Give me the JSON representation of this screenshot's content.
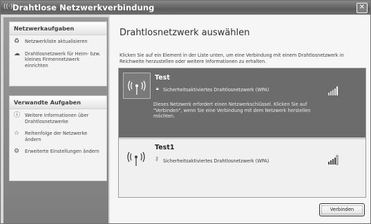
{
  "window": {
    "title": "Drahtlose Netzwerkverbindung",
    "icon": "wireless-icon",
    "close_glyph": "✕"
  },
  "sidebar": {
    "network_tasks": {
      "title": "Netzwerkaufgaben",
      "items": [
        {
          "icon": "refresh-icon",
          "label": "Netzwerkliste aktualisieren"
        },
        {
          "icon": "setup-network-icon",
          "label": "Drahtlosnetzwerk für Heim- bzw. kleines Firmennetzwerk einrichten"
        }
      ]
    },
    "related_tasks": {
      "title": "Verwandte Aufgaben",
      "items": [
        {
          "icon": "info-icon",
          "label": "Weitere Informationen über Drahtlosnetzwerke"
        },
        {
          "icon": "star-icon",
          "label": "Reihenfolge der Netzwerke ändern"
        },
        {
          "icon": "settings-icon",
          "label": "Erweiterte Einstellungen ändern"
        }
      ]
    }
  },
  "main": {
    "heading": "Drahtlosnetzwerk auswählen",
    "description": "Klicken Sie auf ein Element in der Liste unten, um eine Verbindung mit einem Drahtlosnetzwerk in Reichweite herzustellen oder weitere Informationen zu erhalten.",
    "networks": [
      {
        "name": "Test",
        "security": "Sicherheitsaktiviertes Drahtlosnetzwerk (WPA)",
        "info": "Dieses Netzwerk erfordert einen Netzwerkschlüssel. Klicken Sie auf \"Verbinden\", wenn Sie eine Verbindung mit dem Netzwerk herstellen möchten.",
        "signal_bars": 4,
        "selected": true
      },
      {
        "name": "Test1",
        "security": "Sicherheitsaktiviertes Drahtlosnetzwerk (WPA)",
        "signal_bars": 4,
        "selected": false
      }
    ],
    "connect_label": "Verbinden"
  },
  "colors": {
    "selected_bg": "#6c6c6c",
    "sidebar_bg": "#8c8c8c",
    "titlebar_bg": "#6a6a6a"
  }
}
